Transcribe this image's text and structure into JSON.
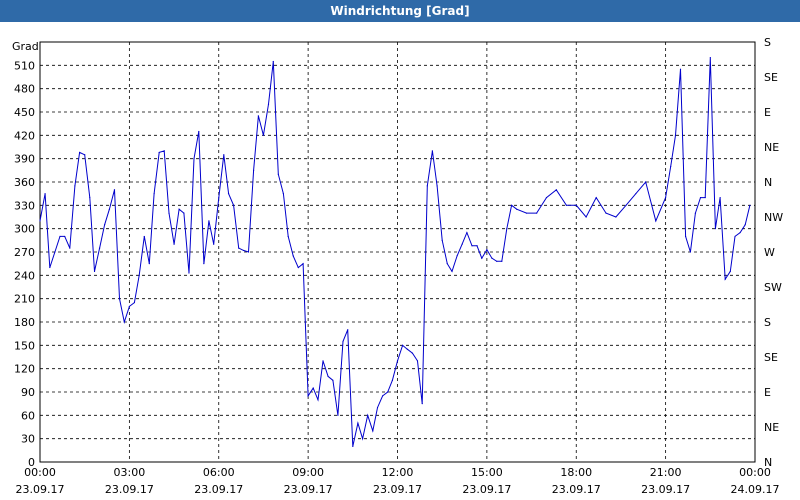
{
  "window": {
    "title": "Windrichtung [Grad]"
  },
  "chart_data": {
    "type": "line",
    "title": "Windrichtung [Grad]",
    "ylabel": "Grad",
    "xlabel": "",
    "ylim": [
      0,
      540
    ],
    "grid": true,
    "x_tick_labels": [
      {
        "time": "00:00",
        "date": "23.09.17"
      },
      {
        "time": "03:00",
        "date": "23.09.17"
      },
      {
        "time": "06:00",
        "date": "23.09.17"
      },
      {
        "time": "09:00",
        "date": "23.09.17"
      },
      {
        "time": "12:00",
        "date": "23.09.17"
      },
      {
        "time": "15:00",
        "date": "23.09.17"
      },
      {
        "time": "18:00",
        "date": "23.09.17"
      },
      {
        "time": "21:00",
        "date": "23.09.17"
      },
      {
        "time": "00:00",
        "date": "24.09.17"
      }
    ],
    "y_ticks": [
      0,
      30,
      60,
      90,
      120,
      150,
      180,
      210,
      240,
      270,
      300,
      330,
      360,
      390,
      420,
      450,
      480,
      510
    ],
    "right_axis_labels": [
      {
        "value": 0,
        "label": "N"
      },
      {
        "value": 45,
        "label": "NE"
      },
      {
        "value": 90,
        "label": "E"
      },
      {
        "value": 135,
        "label": "SE"
      },
      {
        "value": 180,
        "label": "S"
      },
      {
        "value": 225,
        "label": "SW"
      },
      {
        "value": 270,
        "label": "W"
      },
      {
        "value": 315,
        "label": "NW"
      },
      {
        "value": 360,
        "label": "N"
      },
      {
        "value": 405,
        "label": "NE"
      },
      {
        "value": 450,
        "label": "E"
      },
      {
        "value": 495,
        "label": "SE"
      },
      {
        "value": 540,
        "label": "S"
      }
    ],
    "colors": {
      "line": "#0000cc",
      "grid": "#000000",
      "title_bar": "#2f6aa8"
    },
    "series": [
      {
        "x_hours": [
          0.0,
          0.17,
          0.33,
          0.5,
          0.67,
          0.83,
          1.0,
          1.17,
          1.33,
          1.5,
          1.67,
          1.83,
          2.0,
          2.17,
          2.33,
          2.5,
          2.67,
          2.83,
          3.0,
          3.17,
          3.33,
          3.5,
          3.67,
          3.83,
          4.0,
          4.17,
          4.33,
          4.5,
          4.67,
          4.83,
          5.0,
          5.17,
          5.33,
          5.5,
          5.67,
          5.83,
          6.0,
          6.17,
          6.33,
          6.5,
          6.67,
          6.83,
          7.0,
          7.17,
          7.33,
          7.5,
          7.67,
          7.83,
          8.0,
          8.17,
          8.33,
          8.5,
          8.67,
          8.83,
          9.0,
          9.17,
          9.33,
          9.5,
          9.67,
          9.83,
          10.0,
          10.17,
          10.33,
          10.5,
          10.67,
          10.83,
          11.0,
          11.17,
          11.33,
          11.5,
          11.67,
          11.83,
          12.0,
          12.17,
          12.33,
          12.5,
          12.67,
          12.83,
          13.0,
          13.17,
          13.33,
          13.5,
          13.67,
          13.83,
          14.0,
          14.17,
          14.33,
          14.5,
          14.67,
          14.83,
          15.0,
          15.17,
          15.33,
          15.5,
          15.67,
          15.83,
          16.0,
          16.33,
          16.67,
          17.0,
          17.33,
          17.67,
          18.0,
          18.33,
          18.67,
          19.0,
          19.33,
          19.67,
          20.0,
          20.33,
          20.67,
          21.0,
          21.17,
          21.33,
          21.5,
          21.67,
          21.83,
          22.0,
          22.17,
          22.33,
          22.5,
          22.67,
          22.83,
          23.0,
          23.17,
          23.33,
          23.5,
          23.67,
          23.83,
          24.0
        ],
        "values": [
          310,
          345,
          250,
          270,
          290,
          290,
          275,
          355,
          398,
          395,
          340,
          245,
          275,
          305,
          325,
          350,
          210,
          180,
          200,
          205,
          240,
          290,
          255,
          345,
          398,
          400,
          320,
          280,
          325,
          320,
          243,
          390,
          425,
          255,
          310,
          280,
          340,
          395,
          345,
          330,
          275,
          272,
          270,
          375,
          445,
          420,
          460,
          515,
          370,
          345,
          290,
          265,
          250,
          255,
          85,
          95,
          80,
          130,
          110,
          105,
          60,
          155,
          170,
          20,
          50,
          30,
          60,
          40,
          70,
          85,
          90,
          105,
          130,
          150,
          145,
          140,
          130,
          75,
          355,
          400,
          355,
          285,
          255,
          245,
          265,
          280,
          295,
          278,
          278,
          262,
          273,
          262,
          258,
          258,
          300,
          330,
          325,
          320,
          320,
          340,
          350,
          330,
          330,
          315,
          340,
          320,
          315,
          330,
          345,
          360,
          310,
          340,
          380,
          420,
          505,
          290,
          270,
          320,
          340,
          340,
          520,
          300,
          340,
          235,
          245,
          290,
          295,
          305,
          330
        ],
        "ylabel": "Grad"
      }
    ]
  }
}
